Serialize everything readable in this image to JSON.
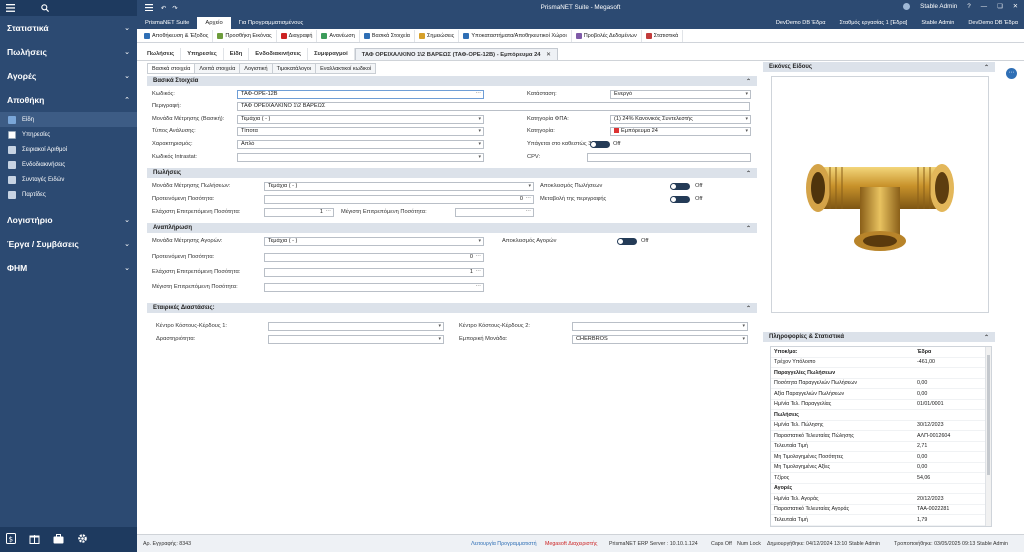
{
  "window": {
    "title": "PrismaNET Suite - Megasoft",
    "user": "Stable Admin",
    "help": "?"
  },
  "sidebar": {
    "sections": [
      "Στατιστικά",
      "Πωλήσεις",
      "Αγορές",
      "Αποθήκη",
      "Λογιστήριο",
      "Έργα / Συμβάσεις",
      "ΦΗΜ"
    ],
    "items": [
      "Είδη",
      "Υπηρεσίες",
      "Σειριακοί Αριθμοί",
      "Ενδοδιακινήσεις",
      "Συνταγές Ειδών",
      "Παρτίδες"
    ]
  },
  "menubar": {
    "tabs": [
      "PrismaNET Suite",
      "Αρχείο",
      "Για Προγραμματισμένους"
    ],
    "db1": "DevDemo DB  Έδρα",
    "station": "Σταθμός εργασίας 1 [Έδρα]",
    "user": "Stable Admin",
    "db2": "DevDemo DB  Έδρα"
  },
  "toolbar": [
    "Αποθήκευση & Έξοδος",
    "Προσθήκη Εικόνας",
    "Διαγραφή",
    "Ανανέωση",
    "Βασικά Στοιχεία",
    "Σημειώσεις",
    "Υποκαταστήματα/Αποθηκευτικοί Χώροι",
    "Προβολές Δεδομένων",
    "Στατιστικά"
  ],
  "doctabs": [
    "Πωλήσεις",
    "Υπηρεσίες",
    "Είδη",
    "Ενδοδιακινήσεις",
    "Συμφραγμοί",
    "ΤΑΦ ΟΡΕΙΧΑΛΚΙΝΟ 1\\2  ΒΑΡΕΩΣ (ΤΑΦ-ΟΡΕ-12Β) - Εμπόρευμα 24"
  ],
  "subtabs": [
    "Βασικά στοιχεία",
    "Λοιπά στοιχεία",
    "Λογιστική",
    "Τιμοκατάλογοι",
    "Εναλλακτικοί κωδικοί"
  ],
  "basic": {
    "header": "Βασικά Στοιχεία",
    "code_label": "Κωδικός:",
    "code": "ΤΑΦ-ΟΡΕ-12Β",
    "desc_label": "Περιγραφή:",
    "desc": "ΤΑΦ ΟΡΕΙΧΑΛΚΙΝΟ 1\\2  ΒΑΡΕΩΣ",
    "unit_label": "Μονάδα Μέτρησης (Βασική):",
    "unit": "Τεμάχια ( - )",
    "analysis_label": "Τύπος Ανάλυσης:",
    "analysis": "Τίποτα",
    "char_label": "Χαρακτηρισμός:",
    "char": "Απλό",
    "intrastat_label": "Κωδικός Intrastat:",
    "intrastat": "",
    "status_label": "Κατάσταση:",
    "status": "Ενεργό",
    "vat_label": "Κατηγορία ΦΠΑ:",
    "vat": "(1) 24% Κανονικός Συντελεστής",
    "cat_label": "Κατηγορία:",
    "cat": "Εμπόρευμα 24",
    "art39_label": "Υπάγεται στο καθεστώς 39Α",
    "art39": "Off",
    "cpv_label": "CPV:",
    "cpv": ""
  },
  "sales": {
    "header": "Πωλήσεις",
    "unit_label": "Μονάδα Μέτρησης Πωλήσεων:",
    "unit": "Τεμάχια ( - )",
    "rec_label": "Προτεινόμενη Ποσότητα:",
    "rec": "0",
    "min_label": "Ελάχιστη Επιτρεπόμενη Ποσότητα:",
    "min": "1",
    "max_label": "Μέγιστη Επιτρεπόμενη Ποσότητα:",
    "max": "",
    "excl_label": "Αποκλεισμός Πωλήσεων",
    "excl": "Off",
    "chg_label": "Μεταβολή της περιγραφής",
    "chg": "Off"
  },
  "purch": {
    "header": "Αναπλήρωση",
    "unit_label": "Μονάδα Μέτρησης Αγορών:",
    "unit": "Τεμάχια ( - )",
    "rec_label": "Προτεινόμενη Ποσότητα:",
    "rec": "0",
    "min_label": "Ελάχιστη Επιτρεπόμενη Ποσότητα:",
    "min": "1",
    "max_label": "Μέγιστη Επιτρεπόμενη Ποσότητα:",
    "max": "",
    "excl_label": "Αποκλεισμός Αγορών",
    "excl": "Off"
  },
  "dims": {
    "header": "Εταιρικές Διαστάσεις:",
    "cc1_label": "Κέντρο Κόστους-Κέρδους 1:",
    "cc1": "",
    "cc2_label": "Κέντρο Κόστους-Κέρδους 2:",
    "cc2": "",
    "act_label": "Δραστηριότητα:",
    "act": "",
    "bu_label": "Εμπορική Μονάδα:",
    "bu": "CHERBROS"
  },
  "images": {
    "header": "Εικόνες Είδους"
  },
  "info": {
    "header": "Πληροφορίες & Στατιστικά",
    "rows": [
      {
        "k": "Υποκ/μα:",
        "v": "Έδρα",
        "hd": true
      },
      {
        "k": "Τρέχον Υπόλοιπο",
        "v": "-461,00"
      },
      {
        "k": "Παραγγελίες Πωλήσεων",
        "v": "",
        "hd": true
      },
      {
        "k": "Ποσότητα Παραγγελιών Πωλήσεων",
        "v": "0,00"
      },
      {
        "k": "Αξία Παραγγελιών Πωλήσεων",
        "v": "0,00"
      },
      {
        "k": "Ημ/νία Τελ. Παραγγελίας",
        "v": "01/01/0001"
      },
      {
        "k": "Πωλήσεις",
        "v": "",
        "hd": true
      },
      {
        "k": "Ημ/νία Τελ. Πώλησης",
        "v": "30/12/2023"
      },
      {
        "k": "Παραστατικό Τελευταίας Πώλησης",
        "v": "ΑΛΠ-0012604"
      },
      {
        "k": "Τελευταία Τιμή",
        "v": "2,71"
      },
      {
        "k": "Μη Τιμολογημένες Ποσότητες",
        "v": "0,00"
      },
      {
        "k": "Μη Τιμολογημένες Αξίες",
        "v": "0,00"
      },
      {
        "k": "Τζίρος",
        "v": "54,06"
      },
      {
        "k": "Αγορές",
        "v": "",
        "hd": true
      },
      {
        "k": "Ημ/νία Τελ. Αγοράς",
        "v": "20/12/2023"
      },
      {
        "k": "Παραστατικό Τελευταίας Αγοράς",
        "v": "ΤΑΑ-0022281"
      },
      {
        "k": "Τελευταία Τιμή",
        "v": "1,79"
      }
    ]
  },
  "status": {
    "rec": "Αρ. Εγγραφής: 8343",
    "prog": "Λειτουργία Προγραμματιστή",
    "mgmt": "Megasoft Διαχειριστής",
    "server": "PrismaNET ERP Server : 10.10.1.124",
    "caps": "Caps Off",
    "num": "Num Lock",
    "created": "Δημιουργήθηκε: 04/12/2024 13:10 Stable Admin",
    "modified": "Τροποποιήθηκε: 03/05/2025 09:13 Stable Admin"
  },
  "colors": {
    "sidebar": "#2c4a72",
    "accent": "#2f6fb5",
    "toggle": "#243b57",
    "red": "#cc2222"
  }
}
